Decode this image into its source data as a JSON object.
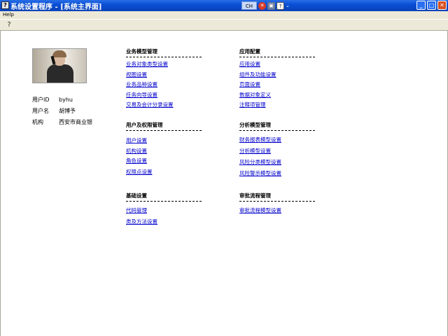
{
  "window": {
    "title": "系统设置程序 - [系统主界面]",
    "app_icon_glyph": "?",
    "ime_label": "CH",
    "ime_help_glyph": "?",
    "ime_down_glyph": "⌄",
    "minimize_glyph": "_",
    "maximize_glyph": "□",
    "close_glyph": "✕"
  },
  "menu": {
    "help": "Help"
  },
  "toolbar": {
    "help_glyph": "?"
  },
  "user": {
    "id_label": "用户ID",
    "id_value": "byhu",
    "name_label": "用户名",
    "name_value": "胡博予",
    "org_label": "机构",
    "org_value": "西安市商业银"
  },
  "sections": {
    "business": {
      "title": "业务模型管理",
      "links": [
        "业务对象类型设置",
        "视图设置",
        "业务品种设置",
        "任务向导设置",
        "交易及会计分录设置"
      ]
    },
    "app_config": {
      "title": "应用配置",
      "links": [
        "应用设置",
        "组件及功能设置",
        "页面设置",
        "数据对象定义",
        "注释项管理"
      ]
    },
    "users": {
      "title": "用户及权限管理",
      "links": [
        "用户设置",
        "机构设置",
        "角色设置",
        "权限点设置"
      ]
    },
    "analysis": {
      "title": "分析模型管理",
      "links": [
        "财务报表模型设置",
        "分析模型设置",
        "风险分类模型设置",
        "风险警示模型设置"
      ]
    },
    "basic": {
      "title": "基础设置",
      "links": [
        "代码管理",
        "类及方法设置"
      ]
    },
    "approval": {
      "title": "审批流程管理",
      "links": [
        "审批流程模型设置"
      ]
    }
  }
}
